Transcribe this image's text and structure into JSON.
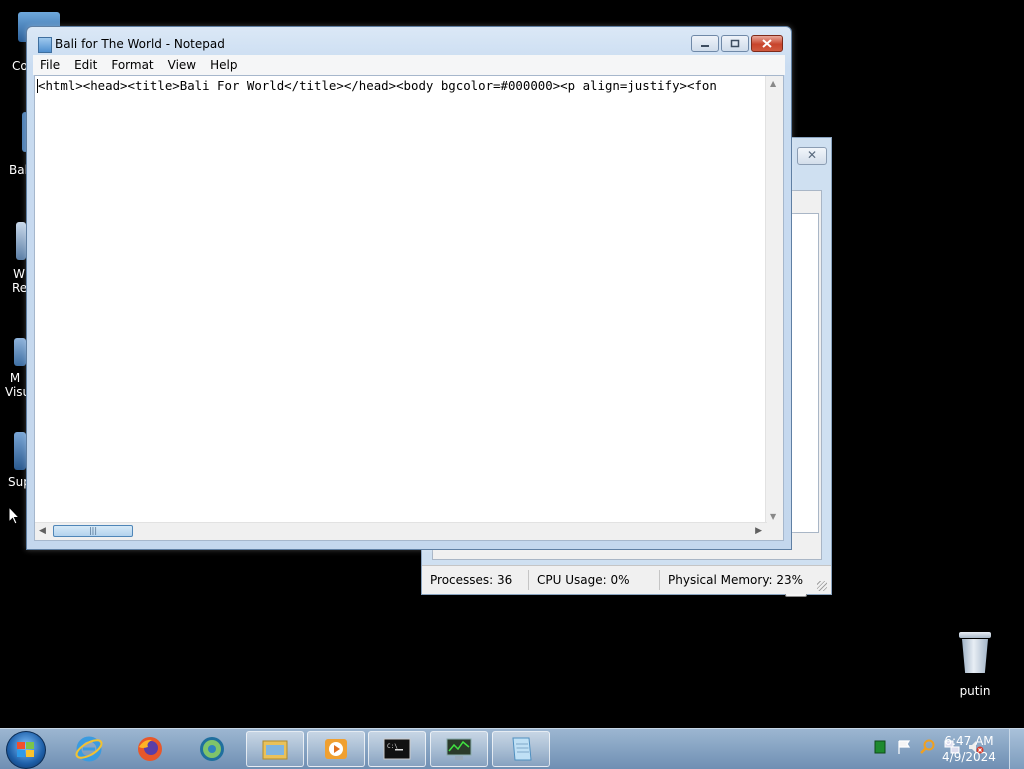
{
  "desktop": {
    "icons": [
      {
        "label": "Co"
      },
      {
        "label": "Bal"
      },
      {
        "label": "W Re"
      },
      {
        "label": "M Visu"
      },
      {
        "label": "Sup"
      }
    ],
    "recycle_bin_label": "putin"
  },
  "notepad": {
    "title": "Bali for The World - Notepad",
    "menu": [
      "File",
      "Edit",
      "Format",
      "View",
      "Help"
    ],
    "content": "<html><head><title>Bali For World</title></head><body bgcolor=#000000><p align=justify><fon"
  },
  "task_manager": {
    "close_label": "✕",
    "status": {
      "processes": "Processes: 36",
      "cpu": "CPU Usage: 0%",
      "memory": "Physical Memory: 23%"
    }
  },
  "taskbar": {
    "items": [
      {
        "icon": "internet-explorer-icon"
      },
      {
        "icon": "firefox-icon"
      },
      {
        "icon": "browser-globe-icon"
      },
      {
        "icon": "windows-explorer-icon"
      },
      {
        "icon": "media-player-icon"
      },
      {
        "icon": "command-prompt-icon"
      },
      {
        "icon": "task-manager-icon"
      },
      {
        "icon": "notepad-icon"
      }
    ],
    "clock": {
      "time": "6:47 AM",
      "date": "4/9/2024"
    }
  },
  "colors": {
    "desktop_bg": "#000000",
    "taskbar": "#7f9fc2",
    "close_red": "#c8442c"
  }
}
